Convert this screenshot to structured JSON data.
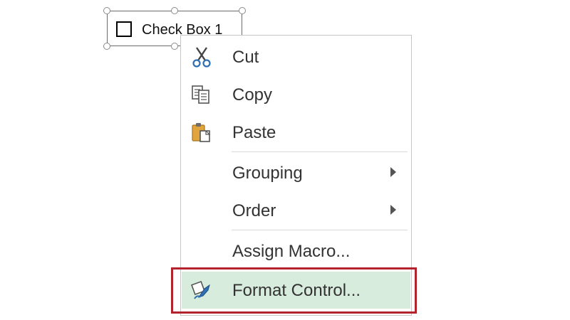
{
  "form_control": {
    "label": "Check Box 1",
    "icon": "checkbox-square-icon"
  },
  "context_menu": {
    "items": [
      {
        "label": "Cut",
        "icon": "scissors-icon",
        "submenu": false
      },
      {
        "label": "Copy",
        "icon": "copy-icon",
        "submenu": false
      },
      {
        "label": "Paste",
        "icon": "paste-icon",
        "submenu": false
      },
      {
        "label": "Grouping",
        "icon": null,
        "submenu": true
      },
      {
        "label": "Order",
        "icon": null,
        "submenu": true
      },
      {
        "label": "Assign Macro...",
        "icon": null,
        "submenu": false
      },
      {
        "label": "Format Control...",
        "icon": "format-control-icon",
        "submenu": false,
        "highlighted": true
      }
    ]
  },
  "colors": {
    "highlight_fill": "#d7ecdc",
    "callout_border": "#b3232b",
    "paste_icon": "#e0a63d"
  }
}
